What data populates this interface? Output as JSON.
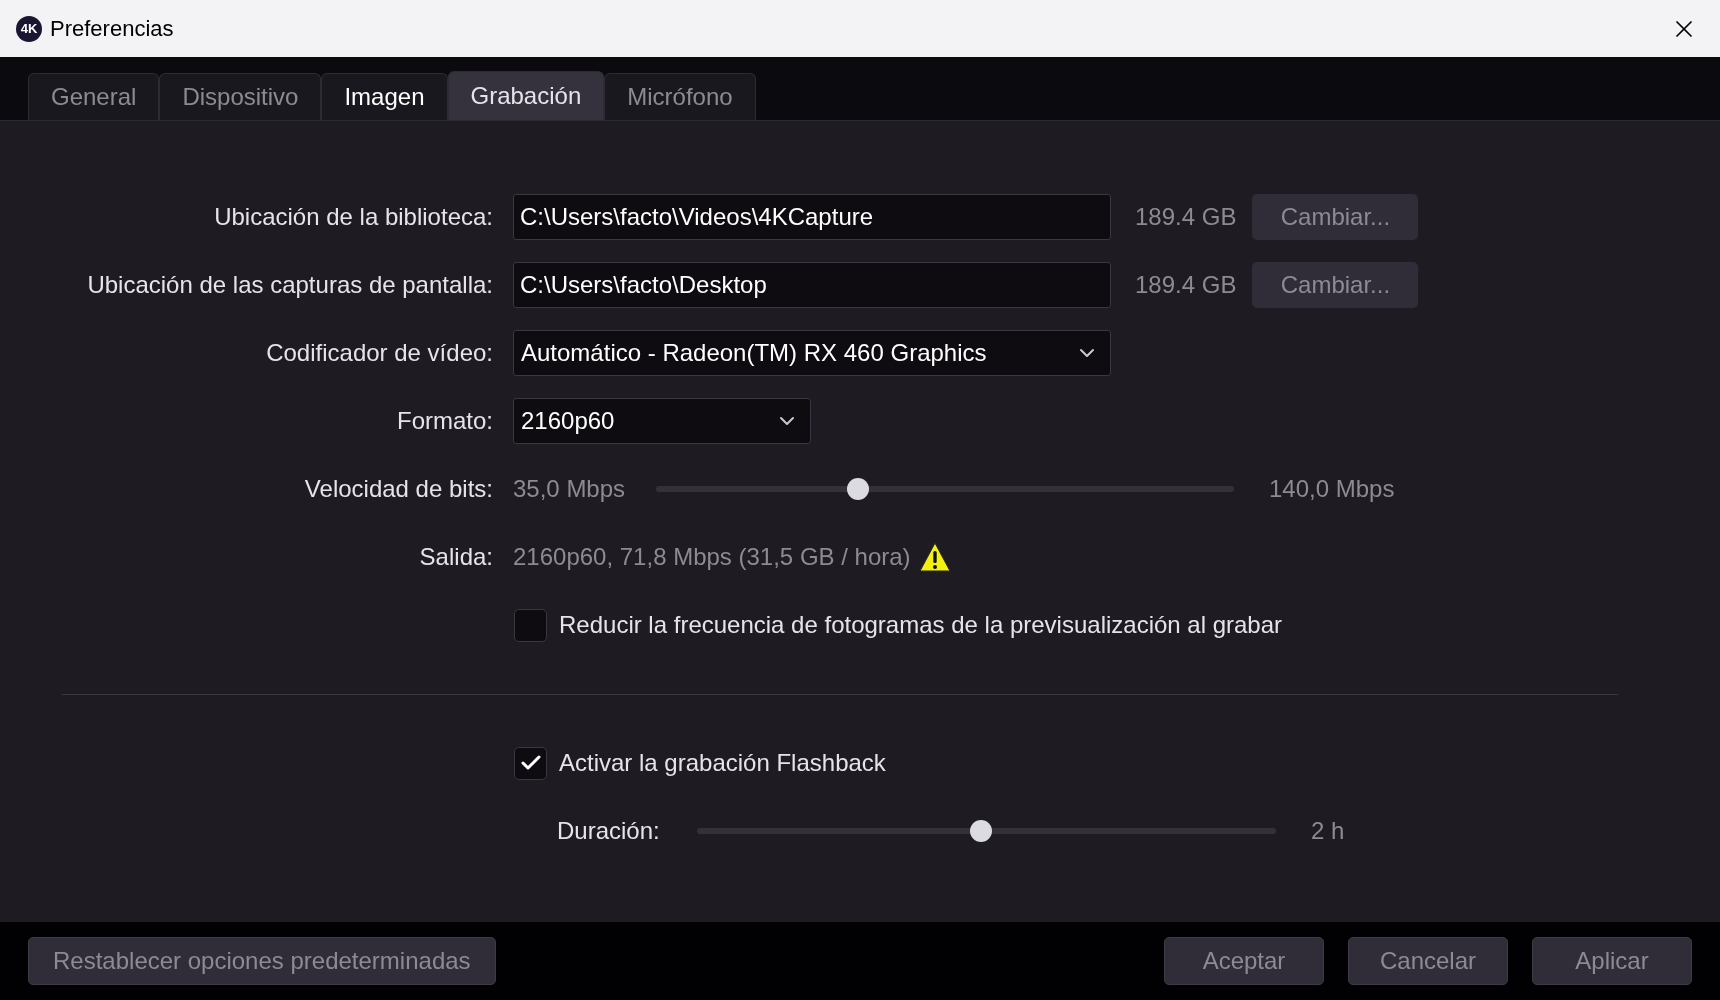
{
  "window": {
    "title": "Preferencias",
    "logo": "4K"
  },
  "tabs": [
    {
      "label": "General",
      "selected": false,
      "hovered": false
    },
    {
      "label": "Dispositivo",
      "selected": false,
      "hovered": false
    },
    {
      "label": "Imagen",
      "selected": false,
      "hovered": true
    },
    {
      "label": "Grabación",
      "selected": true,
      "hovered": false
    },
    {
      "label": "Micrófono",
      "selected": false,
      "hovered": false
    }
  ],
  "rows": [
    {
      "kind": "path",
      "label": "Ubicación de la biblioteca:",
      "value": "C:\\Users\\facto\\Videos\\4KCapture",
      "free": "189.4 GB",
      "button": "Cambiar..."
    },
    {
      "kind": "path",
      "label": "Ubicación de las capturas de pantalla:",
      "value": "C:\\Users\\facto\\Desktop",
      "free": "189.4 GB",
      "button": "Cambiar..."
    },
    {
      "kind": "select",
      "label": "Codificador de vídeo:",
      "value": "Automático - Radeon(TM) RX 460 Graphics",
      "wide": true
    },
    {
      "kind": "select",
      "label": "Formato:",
      "value": "2160p60",
      "wide": false
    },
    {
      "kind": "slider",
      "label": "Velocidad de bits:",
      "min": "35,0 Mbps",
      "max": "140,0 Mbps",
      "level": 0.35
    },
    {
      "kind": "info",
      "label": "Salida:",
      "value": "2160p60, 71,8 Mbps (31,5 GB / hora)",
      "warning": true
    },
    {
      "kind": "checkbox",
      "label": "Reducir la frecuencia de fotogramas de la previsualización al grabar",
      "checked": false
    },
    {
      "kind": "divider"
    },
    {
      "kind": "checkbox",
      "label": "Activar la grabación Flashback",
      "checked": true
    },
    {
      "kind": "subslider",
      "label": "Duración:",
      "max": "2 h",
      "level": 0.49
    }
  ],
  "footer": {
    "reset": "Restablecer opciones predeterminadas",
    "buttons": [
      "Aceptar",
      "Cancelar",
      "Aplicar"
    ]
  }
}
